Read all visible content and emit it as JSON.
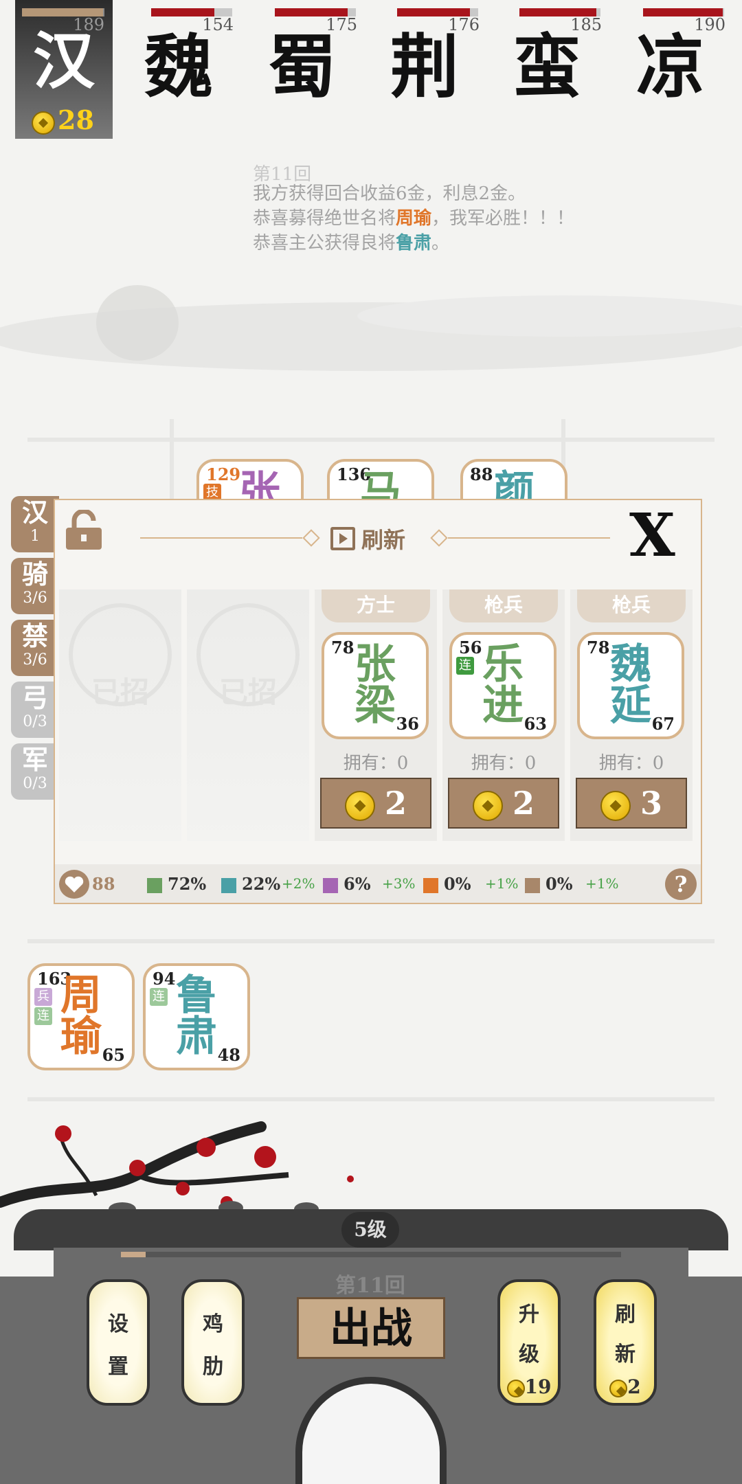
{
  "kingdoms": [
    {
      "name": "汉",
      "value": "189",
      "hp": 0.98,
      "player": true
    },
    {
      "name": "魏",
      "value": "154",
      "hp": 0.78
    },
    {
      "name": "蜀",
      "value": "175",
      "hp": 0.9
    },
    {
      "name": "荆",
      "value": "176",
      "hp": 0.9
    },
    {
      "name": "蛮",
      "value": "185",
      "hp": 0.95
    },
    {
      "name": "凉",
      "value": "190",
      "hp": 0.98
    }
  ],
  "player_gold": "28",
  "log": {
    "line0": "第11回",
    "line1": "我方获得回合收益6金，利息2金。",
    "line2_pre": "恭喜募得绝世名将",
    "line2_name": "周瑜",
    "line2_post": "，我军必胜！！！",
    "line3_pre": "恭喜主公获得良将",
    "line3_name": "鲁肃",
    "line3_post": "。"
  },
  "board_cards": [
    {
      "atk": "129",
      "name": "张",
      "tag": "技",
      "color": "#a565b3"
    },
    {
      "atk": "136",
      "name": "马",
      "color": "#6aa060"
    },
    {
      "atk": "88",
      "name": "颜",
      "color": "#4aa0a6"
    }
  ],
  "side_tabs": [
    {
      "title": "汉",
      "count": "1"
    },
    {
      "title": "骑",
      "count": "3/6"
    },
    {
      "title": "禁",
      "count": "3/6"
    },
    {
      "title": "弓",
      "count": "0/3"
    },
    {
      "title": "军",
      "count": "0/3"
    }
  ],
  "shop": {
    "refresh_label": "刷新",
    "close_label": "X",
    "sold_label": "已招",
    "owned_label": "拥有：",
    "slots": [
      {
        "type": "方士",
        "atk": "78",
        "hp": "36",
        "name1": "张",
        "name2": "梁",
        "owned": "0",
        "cost": "2",
        "color": "#6aa060"
      },
      {
        "type": "枪兵",
        "atk": "56",
        "hp": "63",
        "name1": "乐",
        "name2": "进",
        "owned": "0",
        "cost": "2",
        "tag": "连",
        "color": "#6aa060"
      },
      {
        "type": "枪兵",
        "atk": "78",
        "hp": "67",
        "name1": "魏",
        "name2": "延",
        "owned": "0",
        "cost": "3",
        "color": "#4aa0a6"
      }
    ],
    "hearts": "88",
    "odds": [
      {
        "color": "#6aa060",
        "pct": "72%",
        "delta": ""
      },
      {
        "color": "#4aa0a6",
        "pct": "22%",
        "delta": "+2%"
      },
      {
        "color": "#a565b3",
        "pct": "6%",
        "delta": "+3%"
      },
      {
        "color": "#e0762a",
        "pct": "0%",
        "delta": "+1%"
      },
      {
        "color": "#a8876a",
        "pct": "0%",
        "delta": "+1%"
      }
    ],
    "help_label": "?"
  },
  "bench": [
    {
      "atk": "163",
      "hp": "65",
      "name1": "周",
      "name2": "瑜",
      "tags": [
        "兵",
        "连"
      ],
      "color": "#e0762a"
    },
    {
      "atk": "94",
      "hp": "48",
      "name1": "鲁",
      "name2": "肃",
      "tags": [
        "连"
      ],
      "color": "#4aa0a6"
    }
  ],
  "bottom": {
    "level": "5级",
    "xp": 0.05,
    "round": "第11回",
    "sortie_label": "出战",
    "settings": [
      "设",
      "置"
    ],
    "cheat": [
      "鸡",
      "肋"
    ],
    "upgrade": [
      "升",
      "级"
    ],
    "upgrade_cost": "19",
    "refresh": [
      "刷",
      "新"
    ],
    "refresh_cost": "2"
  }
}
